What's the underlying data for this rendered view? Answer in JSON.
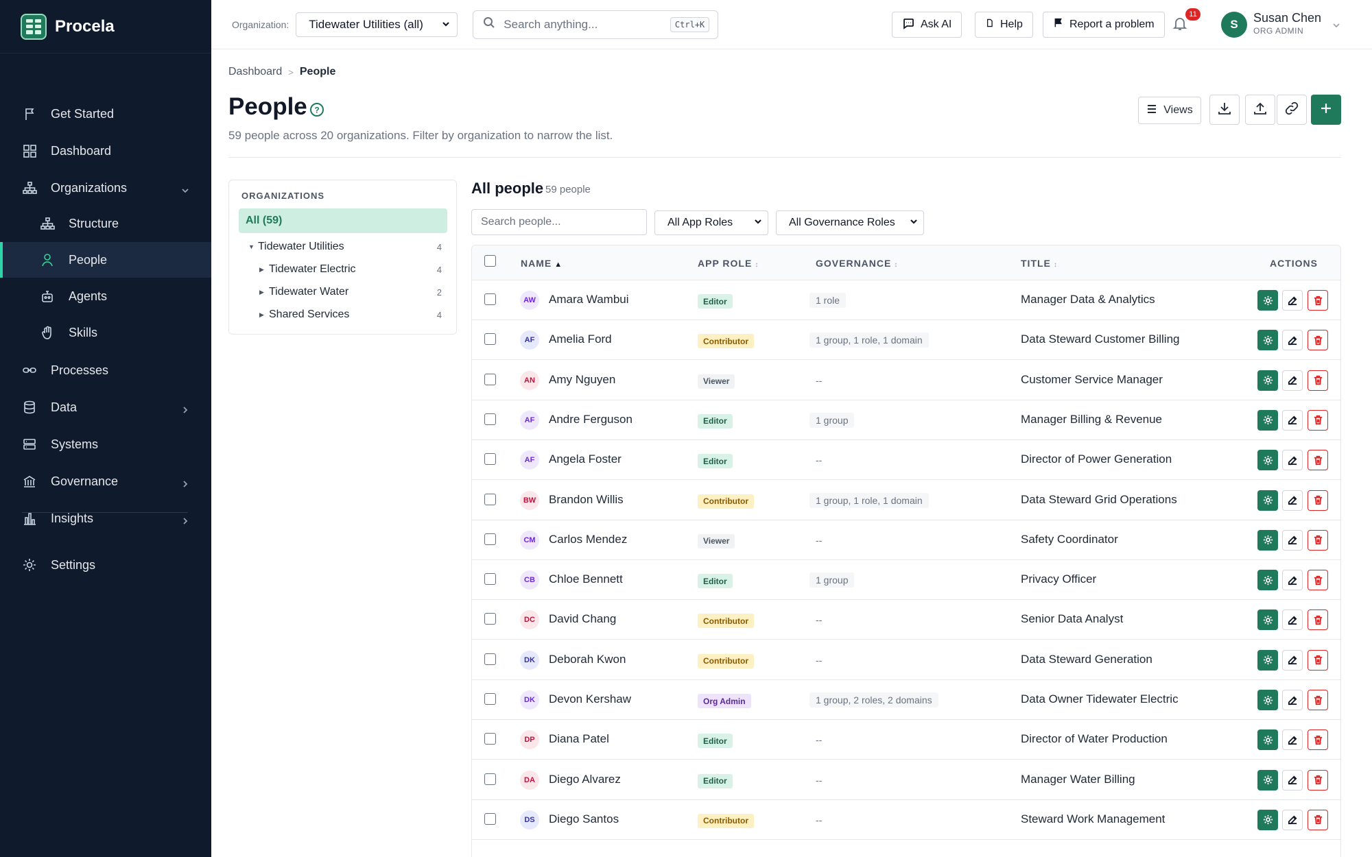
{
  "app": {
    "name": "Procela"
  },
  "sidebar": {
    "items": [
      {
        "label": "Get Started",
        "icon": "flag-icon"
      },
      {
        "label": "Dashboard",
        "icon": "grid-icon"
      },
      {
        "label": "Organizations",
        "icon": "org-chart-icon",
        "expanded": true
      },
      {
        "label": "Structure",
        "icon": "org-chart-icon",
        "sub": true
      },
      {
        "label": "People",
        "icon": "person-icon",
        "sub": true,
        "active": true
      },
      {
        "label": "Agents",
        "icon": "robot-icon",
        "sub": true
      },
      {
        "label": "Skills",
        "icon": "hand-icon",
        "sub": true
      },
      {
        "label": "Processes",
        "icon": "link-icon"
      },
      {
        "label": "Data",
        "icon": "database-icon"
      },
      {
        "label": "Systems",
        "icon": "server-icon"
      },
      {
        "label": "Governance",
        "icon": "institution-icon"
      },
      {
        "label": "Insights",
        "icon": "bar-chart-icon"
      },
      {
        "label": "Settings",
        "icon": "gear-icon"
      }
    ]
  },
  "topbar": {
    "org_label": "Organization:",
    "org_value": "Tidewater Utilities (all)",
    "search_placeholder": "Search anything...",
    "search_shortcut": "Ctrl+K",
    "ask_ai": "Ask AI",
    "help": "Help",
    "report": "Report a problem",
    "notifications": "11",
    "user": {
      "initial": "S",
      "name": "Susan Chen",
      "role": "ORG ADMIN"
    }
  },
  "breadcrumb": {
    "root": "Dashboard",
    "sep": ">",
    "current": "People"
  },
  "page": {
    "title": "People",
    "subtitle": "59 people across 20 organizations. Filter by organization to narrow the list.",
    "views_label": "Views"
  },
  "org_panel": {
    "title": "ORGANIZATIONS",
    "all": "All (59)",
    "tree": [
      {
        "label": "Tidewater Utilities",
        "count": "4",
        "caret": "▼",
        "level": 0
      },
      {
        "label": "Tidewater Electric",
        "count": "4",
        "caret": "▶",
        "level": 1
      },
      {
        "label": "Tidewater Water",
        "count": "2",
        "caret": "▶",
        "level": 1
      },
      {
        "label": "Shared Services",
        "count": "4",
        "caret": "▶",
        "level": 1
      }
    ]
  },
  "table": {
    "title": "All people",
    "count": "59 people",
    "search_placeholder": "Search people...",
    "filter_app_roles": "All App Roles",
    "filter_gov_roles": "All Governance Roles",
    "headers": {
      "name": "NAME",
      "name_sort": "▲",
      "app_role": "APP ROLE",
      "governance": "GOVERNANCE",
      "title": "TITLE",
      "actions": "ACTIONS",
      "sort_glyph": "↕"
    },
    "rows": [
      {
        "initials": "AW",
        "name": "Amara Wambui",
        "role": "Editor",
        "gov": "1 role",
        "title": "Manager Data & Analytics",
        "avatar_bg": "#efe7fb",
        "avatar_fg": "#6d28d9"
      },
      {
        "initials": "AF",
        "name": "Amelia Ford",
        "role": "Contributor",
        "gov": "1 group, 1 role, 1 domain",
        "title": "Data Steward Customer Billing",
        "avatar_bg": "#e6e9fb",
        "avatar_fg": "#3730a3"
      },
      {
        "initials": "AN",
        "name": "Amy Nguyen",
        "role": "Viewer",
        "gov": "--",
        "title": "Customer Service Manager",
        "avatar_bg": "#fbe6ea",
        "avatar_fg": "#be123c"
      },
      {
        "initials": "AF",
        "name": "Andre Ferguson",
        "role": "Editor",
        "gov": "1 group",
        "title": "Manager Billing & Revenue",
        "avatar_bg": "#efe7fb",
        "avatar_fg": "#6d28d9"
      },
      {
        "initials": "AF",
        "name": "Angela Foster",
        "role": "Editor",
        "gov": "--",
        "title": "Director of Power Generation",
        "avatar_bg": "#efe7fb",
        "avatar_fg": "#6d28d9"
      },
      {
        "initials": "BW",
        "name": "Brandon Willis",
        "role": "Contributor",
        "gov": "1 group, 1 role, 1 domain",
        "title": "Data Steward Grid Operations",
        "avatar_bg": "#fbe6ea",
        "avatar_fg": "#be123c"
      },
      {
        "initials": "CM",
        "name": "Carlos Mendez",
        "role": "Viewer",
        "gov": "--",
        "title": "Safety Coordinator",
        "avatar_bg": "#efe7fb",
        "avatar_fg": "#6d28d9"
      },
      {
        "initials": "CB",
        "name": "Chloe Bennett",
        "role": "Editor",
        "gov": "1 group",
        "title": "Privacy Officer",
        "avatar_bg": "#efe7fb",
        "avatar_fg": "#6d28d9"
      },
      {
        "initials": "DC",
        "name": "David Chang",
        "role": "Contributor",
        "gov": "--",
        "title": "Senior Data Analyst",
        "avatar_bg": "#fbe6ea",
        "avatar_fg": "#be123c"
      },
      {
        "initials": "DK",
        "name": "Deborah Kwon",
        "role": "Contributor",
        "gov": "--",
        "title": "Data Steward Generation",
        "avatar_bg": "#e6e9fb",
        "avatar_fg": "#3730a3"
      },
      {
        "initials": "DK",
        "name": "Devon Kershaw",
        "role": "Org Admin",
        "gov": "1 group, 2 roles, 2 domains",
        "title": "Data Owner Tidewater Electric",
        "avatar_bg": "#efe7fb",
        "avatar_fg": "#6d28d9"
      },
      {
        "initials": "DP",
        "name": "Diana Patel",
        "role": "Editor",
        "gov": "--",
        "title": "Director of Water Production",
        "avatar_bg": "#fbe6ea",
        "avatar_fg": "#be123c"
      },
      {
        "initials": "DA",
        "name": "Diego Alvarez",
        "role": "Editor",
        "gov": "--",
        "title": "Manager Water Billing",
        "avatar_bg": "#fbe6ea",
        "avatar_fg": "#be123c"
      },
      {
        "initials": "DS",
        "name": "Diego Santos",
        "role": "Contributor",
        "gov": "--",
        "title": "Steward Work Management",
        "avatar_bg": "#e6e9fb",
        "avatar_fg": "#3730a3"
      }
    ]
  },
  "colors": {
    "brand": "#1f7a5c",
    "sidebar_bg": "#0f1b2d",
    "active_accent": "#2dd4a7",
    "danger": "#dc2626"
  }
}
